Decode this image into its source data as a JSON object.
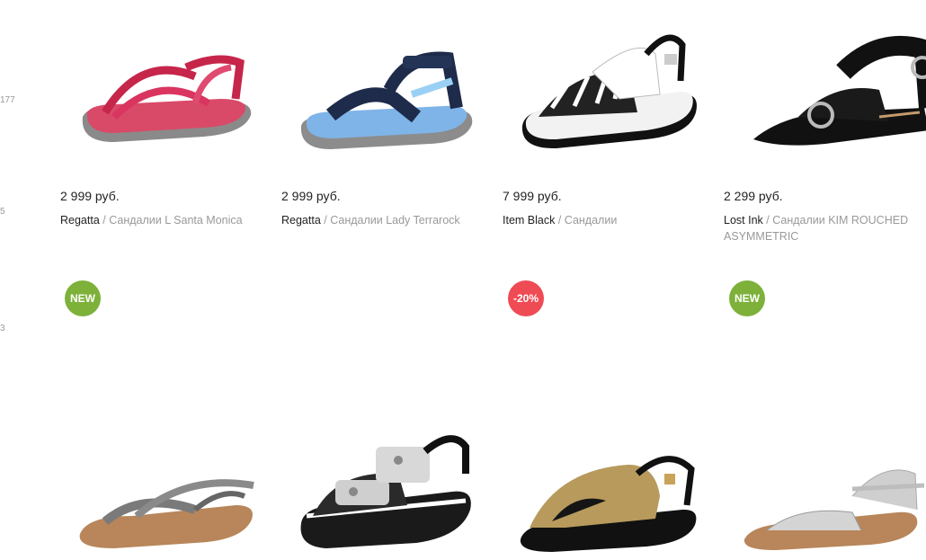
{
  "sidebar": {
    "counts": [
      "177",
      "5",
      "3"
    ]
  },
  "products_row1": [
    {
      "price": "2 999 руб.",
      "brand": "Regatta",
      "sep": " / ",
      "model": "Сандалии L Santa Monica",
      "image": "pink-sport-sandal"
    },
    {
      "price": "2 999 руб.",
      "brand": "Regatta",
      "sep": " / ",
      "model": "Сандалии Lady Terrarock",
      "image": "navy-blue-sport-sandal"
    },
    {
      "price": "7 999 руб.",
      "brand": "Item Black",
      "sep": " / ",
      "model": "Сандалии",
      "image": "black-white-platform-sandal"
    },
    {
      "price": "2 299 руб.",
      "brand": "Lost Ink",
      "sep": " / ",
      "model": "Сандалии KIM ROUCHED ASYMMETRIC",
      "image": "black-pointed-sandal"
    }
  ],
  "products_row2": [
    {
      "badge": "NEW",
      "image": "metallic-strap-flat-sandal"
    },
    {
      "badge": "",
      "image": "black-jeweled-platform-sandal"
    },
    {
      "badge": "-20%",
      "image": "gold-sequin-sandal"
    },
    {
      "badge": "NEW",
      "image": "silver-flat-sandal"
    }
  ],
  "colors": {
    "new_badge": "#7db13a",
    "sale_badge": "#ee4b55",
    "muted_text": "#999999"
  }
}
